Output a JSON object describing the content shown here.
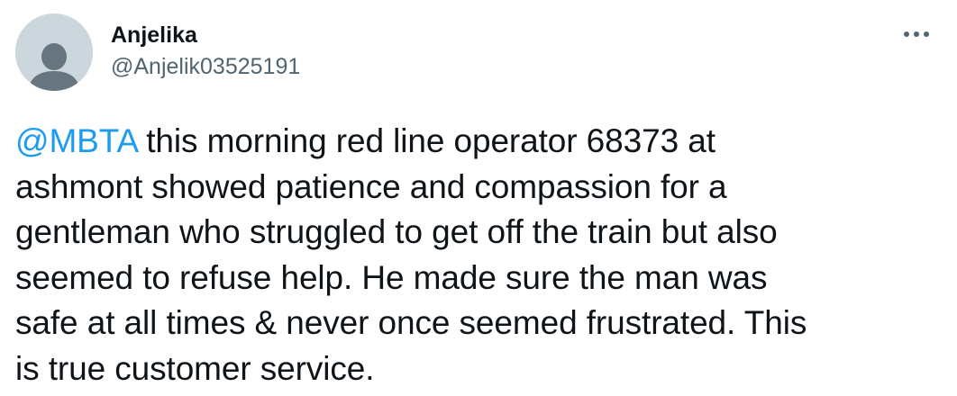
{
  "tweet": {
    "author": {
      "display_name": "Anjelika",
      "handle": "@Anjelik03525191",
      "avatar_icon": "default-profile-icon"
    },
    "more_icon": "more-horizontal-icon",
    "text": {
      "mention": "@MBTA",
      "line1_rest": " this morning red line operator 68373 at",
      "line2": "ashmont showed patience and compassion for a",
      "line3": "gentleman who struggled to get off the train but also",
      "line4": "seemed to refuse help. He made sure the man was",
      "line5": "safe at all times & never once seemed frustrated. This",
      "line6": "is true customer service."
    }
  },
  "colors": {
    "text": "#0f1419",
    "secondary": "#536471",
    "link": "#1d9bf0",
    "avatar_bg": "#ccd6dd",
    "avatar_figure": "#66757f"
  }
}
